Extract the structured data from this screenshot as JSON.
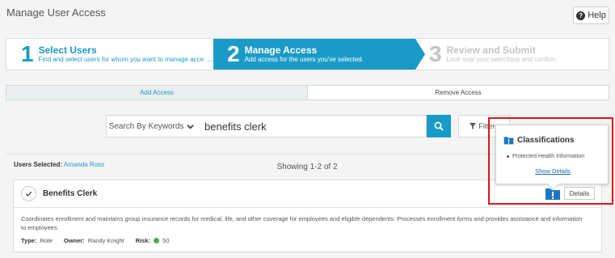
{
  "page": {
    "title": "Manage User Access",
    "help_label": "Help"
  },
  "stepper": {
    "steps": [
      {
        "number": "1",
        "title": "Select Users",
        "subtitle": "Find and select users for whom you want to manage access."
      },
      {
        "number": "2",
        "title": "Manage Access",
        "subtitle": "Add access for the users you've selected."
      },
      {
        "number": "3",
        "title": "Review and Submit",
        "subtitle": "Look over your selections and confirm."
      }
    ]
  },
  "tabs": [
    {
      "label": "Add Access"
    },
    {
      "label": "Remove Access"
    }
  ],
  "search": {
    "mode_label": "Search By Keywords",
    "value": "benefits clerk",
    "filters_label": "Filters"
  },
  "results": {
    "users_selected_label": "Users Selected:",
    "users_selected_value": "Amanda Ross",
    "showing_text": "Showing 1-2 of 2"
  },
  "card": {
    "title": "Benefits Clerk",
    "description": "Coordinates enrollment and maintains group insurance records for medical, life, and other coverage for employees and eligible dependents. Processes enrollment forms and provides assistance and information to employees.",
    "type_label": "Type:",
    "type_value": "Role",
    "owner_label": "Owner:",
    "owner_value": "Randy Knight",
    "risk_label": "Risk:",
    "risk_value": "50",
    "details_label": "Details"
  },
  "popover": {
    "title": "Classifications",
    "item": "Protected Health Information",
    "link_label": "Show Details"
  },
  "colors": {
    "accent": "#1a9bc7",
    "highlight": "#d9141b",
    "risk_low": "#4cb050",
    "flag": "#1a78c2"
  },
  "icons": {
    "help": "question-circle-icon",
    "search": "search-icon",
    "filter": "filter-icon",
    "check": "check-icon",
    "flag": "classification-flag-icon",
    "chevron": "chevron-down-icon"
  }
}
